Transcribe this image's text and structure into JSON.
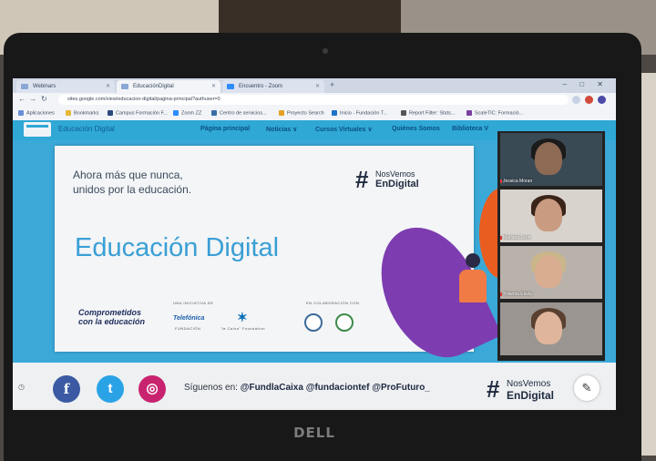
{
  "browser": {
    "tabs": [
      {
        "label": "Webinars",
        "active": false
      },
      {
        "label": "EducaciónDigital",
        "active": true
      },
      {
        "label": "Encuentro - Zoom",
        "active": false
      }
    ],
    "new_tab": "+",
    "window_controls": "–  □  ✕",
    "url": "sites.google.com/view/educacion-digital/pagina-principal?authuser=0",
    "bookmarks": [
      "Aplicaciones",
      "Bookmarks",
      "Campus Formación F...",
      "Zoom ZZ",
      "Centro de servicios...",
      "Proyecto Search",
      "Inicio - Fundación T...",
      "Report Filter: Stats...",
      "ScaleTIC: Formació..."
    ]
  },
  "site": {
    "name": "Educación Digital",
    "nav": [
      "Página principal",
      "Noticias ∨",
      "Cursos Virtuales ∨",
      "Quiénes Somos",
      "Biblioteca V"
    ]
  },
  "banner": {
    "tagline_1": "Ahora más que nunca,",
    "tagline_2": "unidos por la educación.",
    "hash": "#",
    "hashtag_1": "NosVemos",
    "hashtag_2": "EnDigital",
    "headline": "Educación Digital",
    "committed_1": "Comprometidos",
    "committed_2": "con la educación",
    "promoted_label": "UNA INICIATIVA DE",
    "collab_label": "EN COLABORACIÓN CON",
    "partner_1": "Telefónica",
    "partner_1_sub": "FUNDACIÓN",
    "partner_2": "✶",
    "partner_2_sub": "\"la Caixa\" Foundation"
  },
  "footer": {
    "follow_prefix": "Síguenos en:",
    "handles": "@FundlaCaixa @fundaciontef @ProFuturo_",
    "hash": "#",
    "hashtag_1": "NosVemos",
    "hashtag_2": "EnDigital",
    "social": [
      "f",
      "t",
      "◎"
    ],
    "edit": "✎",
    "clock": "◷"
  },
  "participants": [
    {
      "name": "Jessica Moran",
      "bg": "#3a4a55",
      "skin": "#8e6a55",
      "hair": "#1b1b1b"
    },
    {
      "name": "Mariana Leon",
      "bg": "#d8d3cc",
      "skin": "#c99b80",
      "hair": "#3a2418"
    },
    {
      "name": "Yolanda Ekela",
      "bg": "#b9b2ab",
      "skin": "#d9ad90",
      "hair": "#c9b68a"
    },
    {
      "name": "",
      "bg": "#9a9590",
      "skin": "#dfb59c",
      "hair": "#5a4030"
    }
  ],
  "laptop_brand": "DELL",
  "colors": {
    "site_blue": "#2fa8d6",
    "headline_blue": "#3a9fd5",
    "purple": "#7d3cb0",
    "orange": "#ea5d21"
  }
}
